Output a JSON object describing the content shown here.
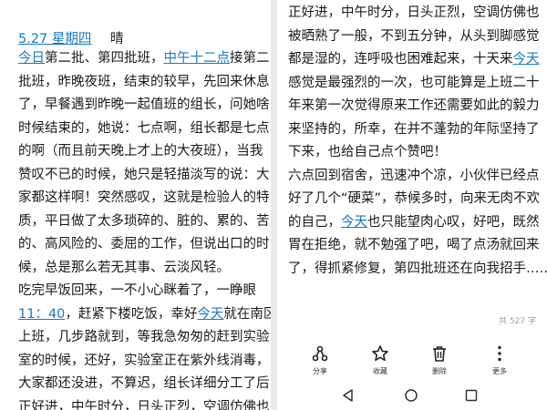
{
  "left": {
    "date": "5.27 星期四",
    "weather": "晴",
    "lines": [
      [
        {
          "t": "今日",
          "hl": true
        },
        {
          "t": "第二批、第四批班，"
        },
        {
          "t": "中午十二点",
          "hl": true
        },
        {
          "t": "接第二"
        }
      ],
      [
        {
          "t": "批班，昨晚夜班，结束的较早，先回来休息"
        }
      ],
      [
        {
          "t": "了，早餐遇到昨晚一起值班的组长，问她啥"
        }
      ],
      [
        {
          "t": "时候结束的，她说：七点啊，组长都是七点"
        }
      ],
      [
        {
          "t": "的啊（而且前天晚上才上的大夜班），当我"
        }
      ],
      [
        {
          "t": "赞叹不已的时候，她只是轻描淡写的说：大"
        }
      ],
      [
        {
          "t": "家都这样啊！突然感叹，这就是检验人的特"
        }
      ],
      [
        {
          "t": "质，平日做了太多琐碎的、脏的、累的、苦"
        }
      ],
      [
        {
          "t": "的、高风险的、委屈的工作，但说出口的时"
        }
      ],
      [
        {
          "t": "候，总是那么若无其事、云淡风轻。"
        }
      ],
      [
        {
          "t": "  吃完早饭回来，一不小心眯着了，一睁眼"
        }
      ],
      [
        {
          "t": "11：40",
          "hl": true
        },
        {
          "t": "，赶紧下楼吃饭，幸好"
        },
        {
          "t": "今天",
          "hl": true
        },
        {
          "t": "就在南区"
        }
      ],
      [
        {
          "t": "上班，几步路就到，等我急匆匆的赶到实验"
        }
      ],
      [
        {
          "t": "室的时候，还好，实验室正在紫外线消毒，"
        }
      ],
      [
        {
          "t": "大家都还没进，不算迟，组长详细分工了后"
        }
      ],
      [
        {
          "t": "正好进，中午时分，日头正烈，空调仿佛也"
        }
      ]
    ]
  },
  "right": {
    "lines": [
      [
        {
          "t": "正好进，中午时分，日头正烈，空调仿佛也"
        }
      ],
      [
        {
          "t": "被晒熟了一般，不到五分钟，从头到脚感觉"
        }
      ],
      [
        {
          "t": "都是湿的，连呼吸也困难起来，十天来"
        },
        {
          "t": "今天",
          "hl": true
        }
      ],
      [
        {
          "t": "感觉是最强烈的一次，也可能算是上班二十"
        }
      ],
      [
        {
          "t": "年来第一次觉得原来工作还需要如此的毅力"
        }
      ],
      [
        {
          "t": "来坚持的，所幸，在并不蓬勃的年际坚持了"
        }
      ],
      [
        {
          "t": "下来，也给自己点个赞吧！"
        }
      ],
      [
        {
          "t": "  六点回到宿舍，迅速冲个凉，小伙伴已经点"
        }
      ],
      [
        {
          "t": "好了几个“硬菜”，恭候多时，向来无肉不欢"
        }
      ],
      [
        {
          "t": "的自己，"
        },
        {
          "t": "今天",
          "hl": true
        },
        {
          "t": "也只能望肉心叹，好吧，既然"
        }
      ],
      [
        {
          "t": "胃在拒绝，就不勉强了吧，喝了点汤就回来"
        }
      ],
      [
        {
          "t": "了，得抓紧修复，第四批班还在向我招手……"
        }
      ]
    ],
    "word_count": "共 527 字",
    "toolbar": [
      {
        "icon": "share-icon",
        "label": "分享"
      },
      {
        "icon": "star-icon",
        "label": "收藏"
      },
      {
        "icon": "trash-icon",
        "label": "删除"
      },
      {
        "icon": "more-icon",
        "label": "更多"
      }
    ],
    "navbar": [
      "back-icon",
      "home-icon",
      "recents-icon"
    ]
  },
  "colors": {
    "link": "#1a78c2",
    "text": "#1a1a1a",
    "muted": "#9a9a9a",
    "divider": "#e9e9e9"
  }
}
